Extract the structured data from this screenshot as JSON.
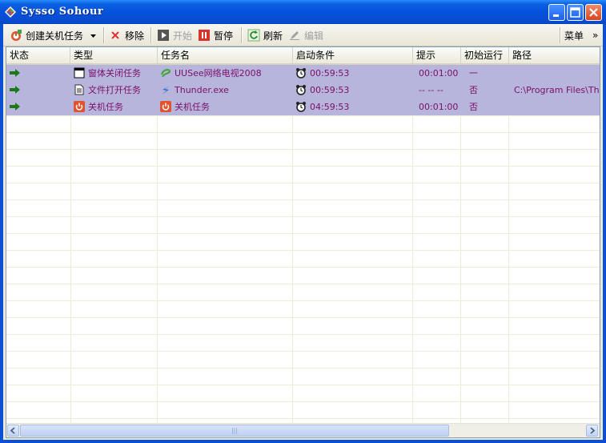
{
  "window": {
    "title": "Sysso Sohour"
  },
  "toolbar": {
    "create": "创建关机任务",
    "remove": "移除",
    "start": "开始",
    "pause": "暂停",
    "refresh": "刷新",
    "edit": "编辑",
    "menu": "菜单",
    "overflow": "»"
  },
  "columns": [
    "状态",
    "类型",
    "任务名",
    "启动条件",
    "提示",
    "初始运行",
    "路径"
  ],
  "rows": [
    {
      "type": "窗体关闭任务",
      "name": "UUSee网络电视2008",
      "condition": "00:59:53",
      "hint": "00:01:00",
      "initial": "一",
      "path": "",
      "type_icon": "window-icon",
      "name_icon": "uusee-icon"
    },
    {
      "type": "文件打开任务",
      "name": "Thunder.exe",
      "condition": "00:59:53",
      "hint": "-- -- --",
      "initial": "否",
      "path": "C:\\Program Files\\Thunder",
      "type_icon": "document-icon",
      "name_icon": "thunder-icon"
    },
    {
      "type": "关机任务",
      "name": "关机任务",
      "condition": "04:59:53",
      "hint": "00:01:00",
      "initial": "否",
      "path": "",
      "type_icon": "power-icon",
      "name_icon": "power-icon"
    }
  ],
  "scrollbar": {
    "grip": "|||"
  }
}
